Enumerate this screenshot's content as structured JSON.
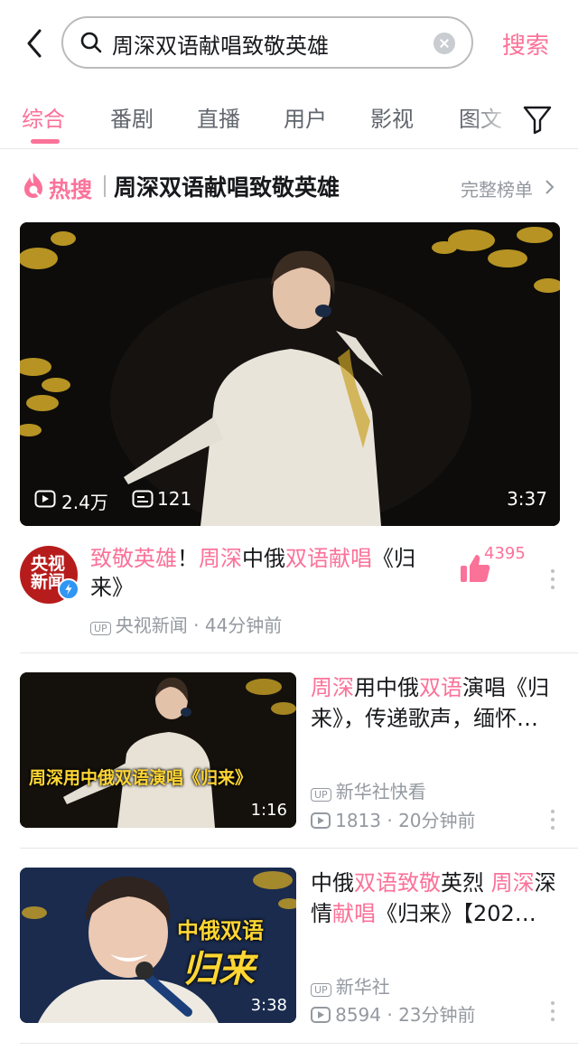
{
  "header": {
    "query": "周深双语献唱致敬英雄",
    "search_label": "搜索"
  },
  "tabs": [
    {
      "label": "综合",
      "active": true
    },
    {
      "label": "番剧"
    },
    {
      "label": "直播"
    },
    {
      "label": "用户"
    },
    {
      "label": "影视"
    },
    {
      "label": "图文"
    }
  ],
  "hot": {
    "label": "热搜",
    "title": "周深双语献唱致敬英雄",
    "full_list": "完整榜单"
  },
  "results": [
    {
      "views": "2.4万",
      "danmaku": "121",
      "duration": "3:37",
      "title_parts": [
        {
          "text": "致敬英雄",
          "hl": true
        },
        {
          "text": "！",
          "hl": false
        },
        {
          "text": "周深",
          "hl": true
        },
        {
          "text": "中俄",
          "hl": false
        },
        {
          "text": "双语献唱",
          "hl": true
        },
        {
          "text": "《归来》",
          "hl": false
        }
      ],
      "likes": "4395",
      "channel_logo_text": "央视新闻",
      "up_badge": "UP",
      "author": "央视新闻",
      "time": "44分钟前"
    },
    {
      "duration": "1:16",
      "caption": "周深用中俄双语演唱《归来》",
      "title_parts": [
        {
          "text": "周深",
          "hl": true
        },
        {
          "text": "用中俄",
          "hl": false
        },
        {
          "text": "双语",
          "hl": true
        },
        {
          "text": "演唱《归来》，传递歌声，缅怀…",
          "hl": false
        }
      ],
      "up_badge": "UP",
      "author": "新华社快看",
      "views": "1813",
      "time": "20分钟前"
    },
    {
      "duration": "3:38",
      "caption_line1": "中俄双语",
      "caption_line2": "归来",
      "title_parts": [
        {
          "text": "中俄",
          "hl": false
        },
        {
          "text": "双语致敬",
          "hl": true
        },
        {
          "text": "英烈 ",
          "hl": false
        },
        {
          "text": "周深",
          "hl": true
        },
        {
          "text": "深情",
          "hl": false
        },
        {
          "text": "献唱",
          "hl": true
        },
        {
          "text": "《归来》【202…",
          "hl": false
        }
      ],
      "up_badge": "UP",
      "author": "新华社",
      "views": "8594",
      "time": "23分钟前"
    }
  ],
  "colors": {
    "accent": "#fb7299",
    "meta": "#9499a0",
    "text": "#18191c"
  },
  "icons": [
    "back-arrow-icon",
    "search-icon",
    "clear-icon",
    "filter-icon",
    "fire-icon",
    "chevron-right-icon",
    "play-count-icon",
    "danmaku-icon",
    "like-icon",
    "more-icon",
    "verified-icon"
  ]
}
